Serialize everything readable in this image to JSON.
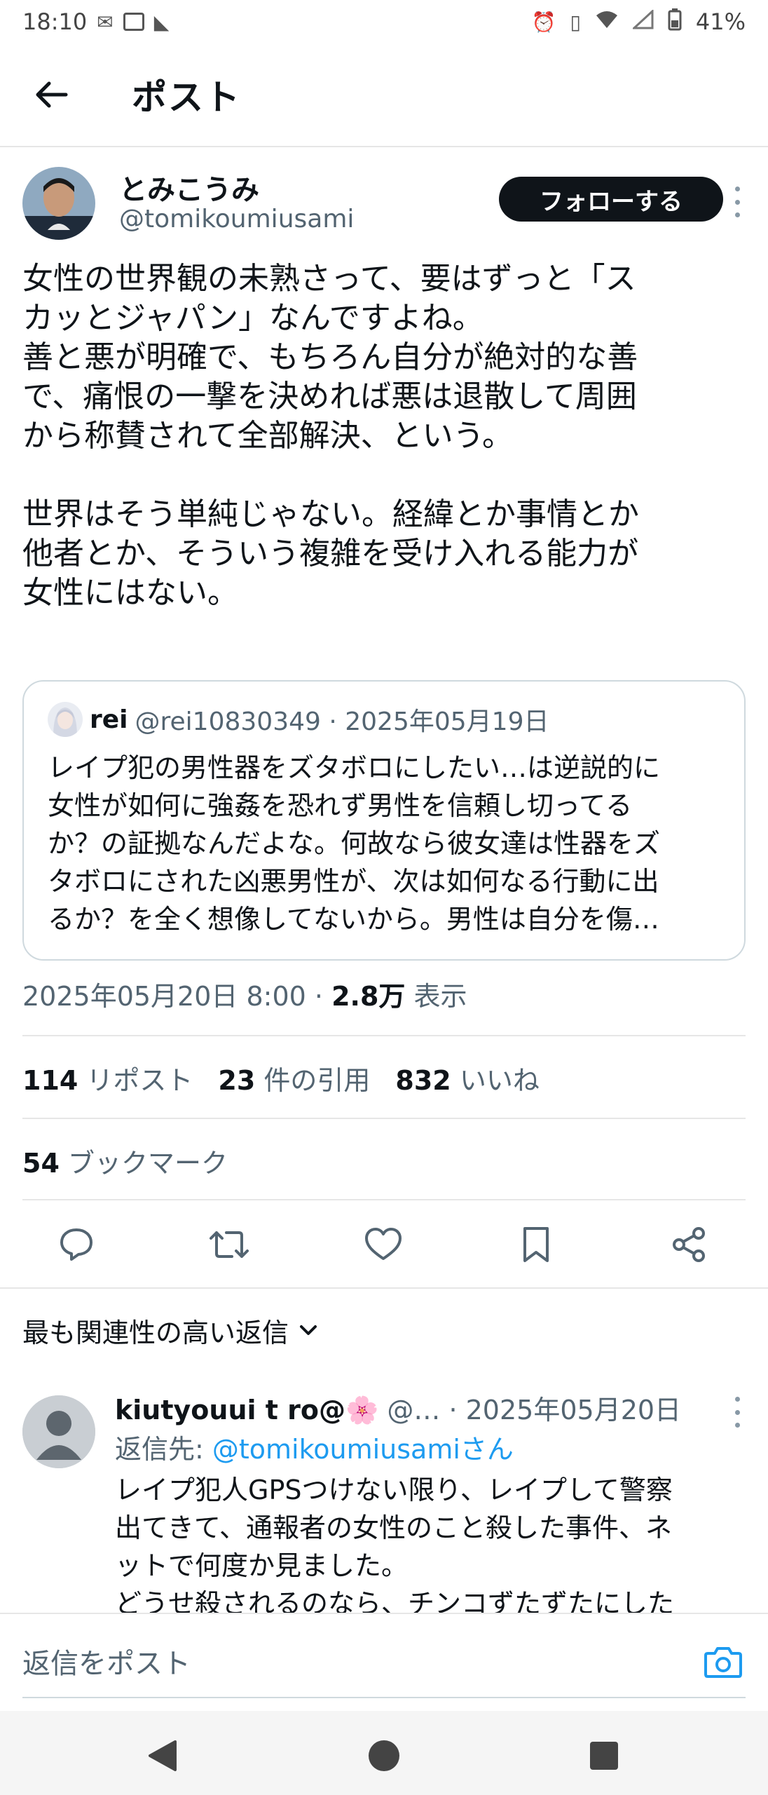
{
  "status_bar": {
    "time": "18:10",
    "notif_icons": [
      "mail-icon",
      "manga-up-icon",
      "dolphin-icon"
    ],
    "battery": "41%",
    "right_icons": [
      "alarm-icon",
      "vibrate-icon",
      "wifi-icon",
      "signal-icon",
      "battery-icon"
    ]
  },
  "header": {
    "title": "ポスト",
    "back_icon": "arrow-left-icon"
  },
  "post": {
    "author_name": "とみこうみ",
    "author_handle": "@tomikoumiusami",
    "follow_label": "フォローする",
    "text": "女性の世界観の未熟さって、要はずっと「ス\nカッとジャパン」なんですよね。\n善と悪が明確で、もちろん自分が絶対的な善\nで、痛恨の一撃を決めれば悪は退散して周囲\nから称賛されて全部解決、という。\n\n世界はそう単純じゃない。経緯とか事情とか\n他者とか、そういう複雑を受け入れる能力が\n女性にはない。",
    "quote": {
      "name": "rei",
      "handle_date": "@rei10830349 · 2025年05月19日",
      "text": "レイプ犯の男性器をズタボロにしたい…は逆説的に\n女性が如何に強姦を恐れず男性を信頼し切ってる\nか？の証拠なんだよな。何故なら彼女達は性器をズ\nタボロにされた凶悪男性が、次は如何なる行動に出\nるか？を全く想像してないから。男性は自分を傷…"
    },
    "timestamp": "2025年05月20日 8:00 · ",
    "views_count": "2.8万",
    "views_label": " 表示",
    "reposts_count": "114",
    "reposts_label": " リポスト",
    "quotes_count": "23",
    "quotes_label": " 件の引用",
    "likes_count": "832",
    "likes_label": " いいね",
    "bookmarks_count": "54",
    "bookmarks_label": " ブックマーク",
    "actions": [
      "reply-icon",
      "repost-icon",
      "like-icon",
      "bookmark-icon",
      "share-icon"
    ]
  },
  "replies": {
    "sort_label": "最も関連性の高い返信",
    "items": [
      {
        "name": "kiutyouui t ro@🌸",
        "meta": " @…  · 2025年05月20日",
        "reply_to_label": "返信先: ",
        "reply_to_handle": "@tomikoumiusamiさん",
        "text": "レイプ犯人GPSつけない限り、レイプして警察\n出てきて、通報者の女性のこと殺した事件、ネ\nットで何度か見ました。\nどうせ殺されるのなら、チンコずたずたにした"
      }
    ]
  },
  "compose": {
    "placeholder": "返信をポスト"
  },
  "colors": {
    "accent": "#1d9bf0",
    "text_primary": "#0f1419",
    "text_secondary": "#536471",
    "follow_bg": "#0f1419"
  }
}
